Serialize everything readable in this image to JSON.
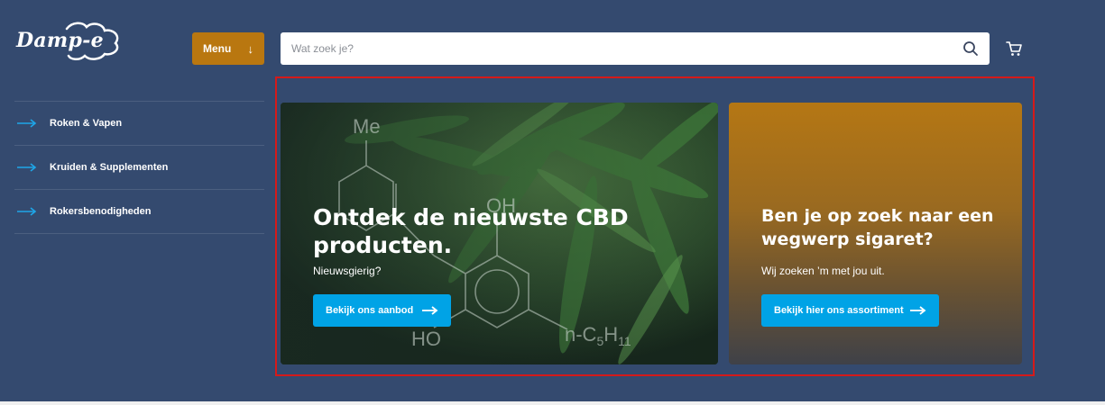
{
  "brand": {
    "logo_text": "Damp-e"
  },
  "header": {
    "menu_label": "Menu",
    "search_placeholder": "Wat zoek je?"
  },
  "sidebar": {
    "items": [
      {
        "label": "Roken & Vapen"
      },
      {
        "label": "Kruiden & Supplementen"
      },
      {
        "label": "Rokersbenodigheden"
      }
    ]
  },
  "hero": {
    "cbd": {
      "title": "Ontdek de nieuwste CBD producten.",
      "subtitle": "Nieuwsgierig?",
      "button": "Bekijk ons aanbod"
    },
    "vape": {
      "title": "Ben je op zoek naar een wegwerp sigaret?",
      "subtitle": "Wij zoeken ’m met jou uit.",
      "button": "Bekijk hier ons assortiment"
    }
  },
  "colors": {
    "background": "#344a6f",
    "accent_orange": "#b97710",
    "button_blue": "#00a3e6",
    "sidebar_arrow": "#1ea6e8",
    "highlight_border": "#d51a1a"
  },
  "icons": {
    "menu": "arrow-down-icon",
    "search": "search-icon",
    "cart": "cart-icon",
    "sidebar": "arrow-right-icon",
    "buttons": "arrow-right-icon"
  }
}
